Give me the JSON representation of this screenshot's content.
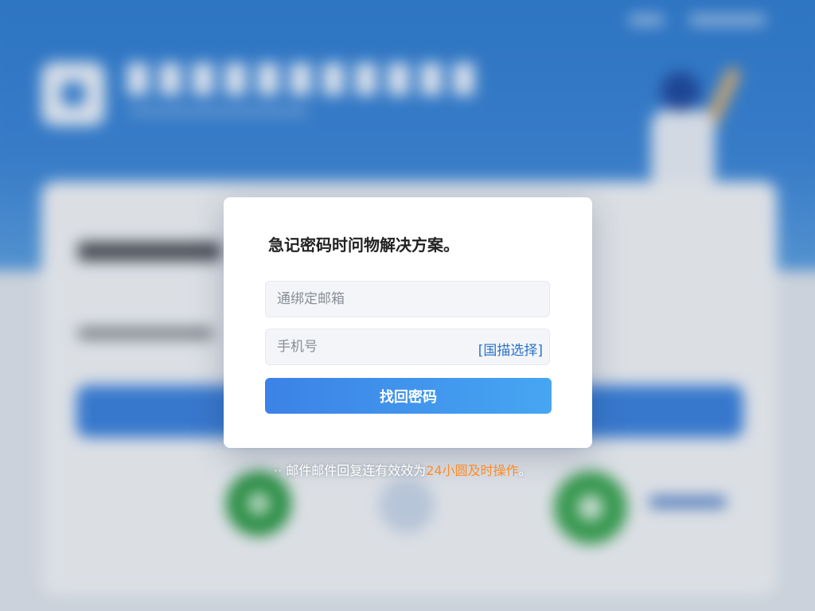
{
  "modal": {
    "title": "急记密码时问物解决方案。",
    "email_placeholder": "通绑定邮箱",
    "phone_placeholder": "手机号",
    "region_select_label": "[国描选择]",
    "submit_label": "找回密码"
  },
  "notice": {
    "prefix_dots": "··",
    "text": "邮件邮件回复连有效效为",
    "highlight": "24小圆及时操作",
    "suffix": "。"
  },
  "colors": {
    "primary": "#3b82e6",
    "highlight": "#ff8a24",
    "link": "#2b73c9",
    "header_bg": "#2f7dd1"
  }
}
